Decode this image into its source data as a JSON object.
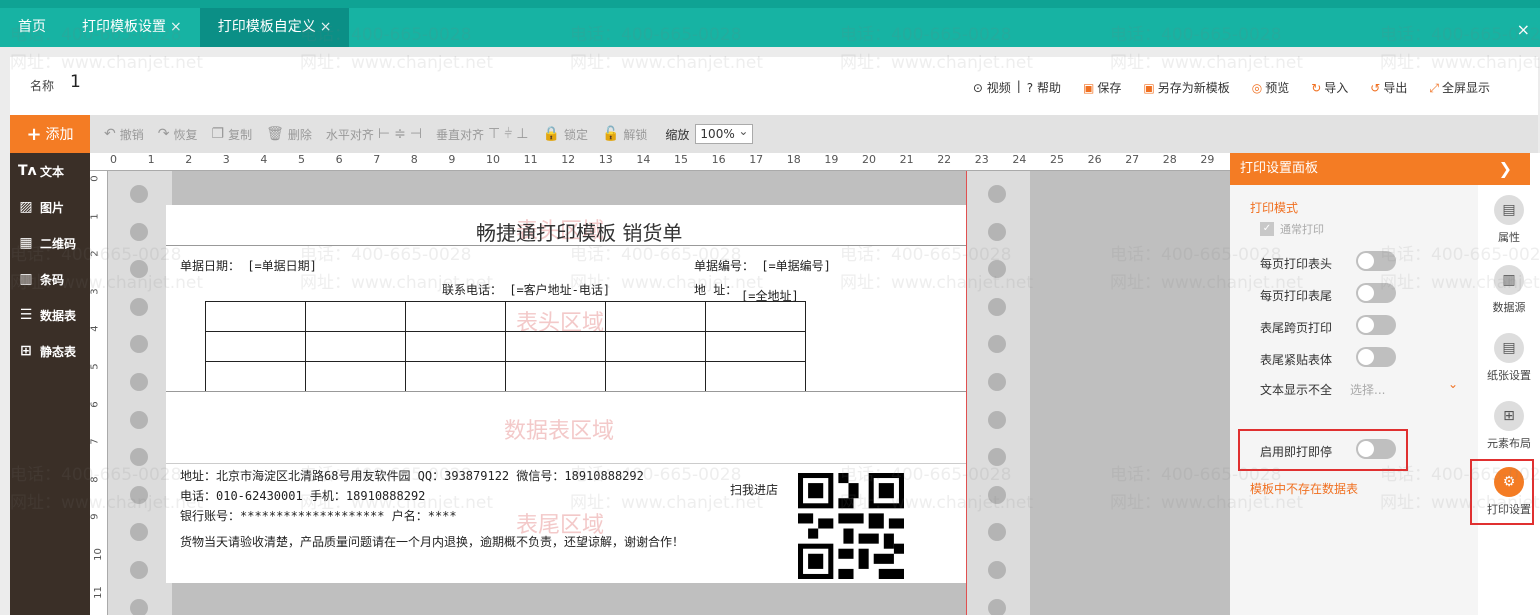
{
  "tabs": [
    {
      "label": "首页",
      "closable": false
    },
    {
      "label": "打印模板设置",
      "closable": true
    },
    {
      "label": "打印模板自定义",
      "closable": true
    }
  ],
  "header": {
    "name_label": "名称",
    "name_value": "1",
    "tools": {
      "video": "视频",
      "help": "帮助",
      "save": "保存",
      "save_as": "另存为新模板",
      "preview": "预览",
      "import": "导入",
      "export": "导出",
      "fullscreen": "全屏显示"
    }
  },
  "toolbar": {
    "add": "添加",
    "undo": "撤销",
    "redo": "恢复",
    "copy": "复制",
    "delete": "删除",
    "halign": "水平对齐",
    "valign": "垂直对齐",
    "lock": "锁定",
    "unlock": "解锁",
    "zoom_label": "缩放",
    "zoom_value": "100%"
  },
  "sidebar": [
    "文本",
    "图片",
    "二维码",
    "条码",
    "数据表",
    "静态表"
  ],
  "ruler": {
    "top": [
      "0",
      "1",
      "2",
      "3",
      "4",
      "5",
      "6",
      "7",
      "8",
      "9",
      "10",
      "11",
      "12",
      "13",
      "14",
      "15",
      "16",
      "17",
      "18",
      "19",
      "20",
      "21",
      "22",
      "23",
      "24",
      "25",
      "26",
      "27",
      "28",
      "29"
    ],
    "left": [
      "0",
      "1",
      "2",
      "3",
      "4",
      "5",
      "6",
      "7",
      "8",
      "9",
      "10",
      "11"
    ]
  },
  "zones": {
    "header": "表头区域",
    "data": "数据表区域",
    "footer": "表尾区域"
  },
  "paper": {
    "title": "畅捷通打印模板  销货单",
    "date": "单据日期： [=单据日期]",
    "number": "单据编号： [=单据编号]",
    "phone": "联系电话： [=客户地址-电话]",
    "addr_label": "地 址：",
    "addr_value": "[=全地址]",
    "footer_addr": "地址：北京市海淀区北清路68号用友软件园    QQ：393879122    微信号：18910888292",
    "footer_tel": "电话：010-62430001         手机：18910888292",
    "footer_bank": "银行账号：********************    户名：****",
    "footer_note": "货物当天请验收清楚，产品质量问题请在一个月内退换，逾期概不负责，还望谅解，谢谢合作！",
    "scan": "扫我进店"
  },
  "panel": {
    "title": "打印设置面板",
    "mode": "打印模式",
    "normal_print": "通常打印",
    "rows": [
      "每页打印表头",
      "每页打印表尾",
      "表尾跨页打印",
      "表尾紧贴表体"
    ],
    "text_overflow": "文本显示不全",
    "text_overflow_value": "选择...",
    "instant_stop": "启用即打即停",
    "warning": "模板中不存在数据表"
  },
  "rail": [
    "属性",
    "数据源",
    "纸张设置",
    "元素布局",
    "打印设置"
  ],
  "watermark": {
    "phone": "电话：400-665-0028",
    "site": "网址：www.chanjet.net"
  },
  "colors": {
    "tab_bar": "#17b3a3",
    "accent": "#f47c24",
    "sidebar": "#3a2f27"
  }
}
